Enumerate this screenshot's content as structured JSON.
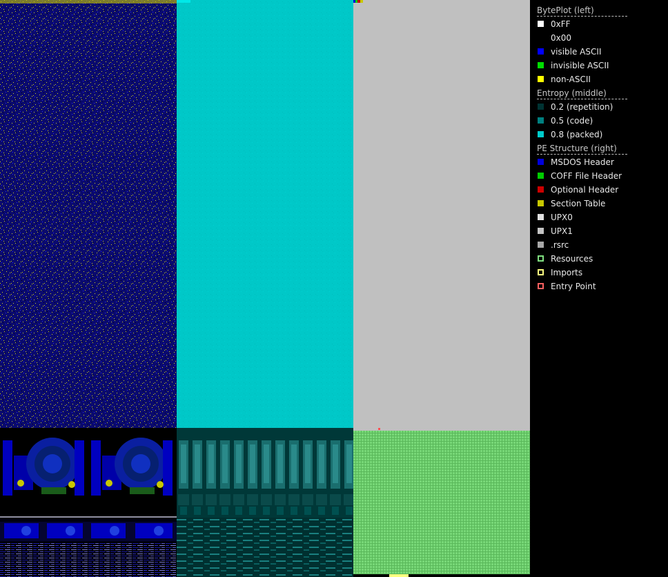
{
  "legend": {
    "groups": [
      {
        "title": "BytePlot (left)",
        "items": [
          {
            "label": "0xFF",
            "color": "#ffffff",
            "outline": ""
          },
          {
            "label": "0x00",
            "color": "#000000",
            "outline": ""
          },
          {
            "label": "visible ASCII",
            "color": "#0000ff",
            "outline": ""
          },
          {
            "label": "invisible ASCII",
            "color": "#00dd00",
            "outline": ""
          },
          {
            "label": "non-ASCII",
            "color": "#ffff00",
            "outline": ""
          }
        ]
      },
      {
        "title": "Entropy (middle)",
        "items": [
          {
            "label": "0.2 (repetition)",
            "color": "#003333",
            "outline": ""
          },
          {
            "label": "0.5 (code)",
            "color": "#008080",
            "outline": ""
          },
          {
            "label": "0.8 (packed)",
            "color": "#00cccc",
            "outline": ""
          }
        ]
      },
      {
        "title": "PE Structure (right)",
        "items": [
          {
            "label": "MSDOS Header",
            "color": "#0000dd",
            "outline": ""
          },
          {
            "label": "COFF File Header",
            "color": "#00cc00",
            "outline": ""
          },
          {
            "label": "Optional Header",
            "color": "#cc0000",
            "outline": ""
          },
          {
            "label": "Section Table",
            "color": "#c8c800",
            "outline": ""
          },
          {
            "label": "UPX0",
            "color": "#e0e0e0",
            "outline": ""
          },
          {
            "label": "UPX1",
            "color": "#c4c4c4",
            "outline": ""
          },
          {
            "label": ".rsrc",
            "color": "#a8a8a8",
            "outline": ""
          },
          {
            "label": "Resources",
            "color": "#000000",
            "outline": "#80e080"
          },
          {
            "label": "Imports",
            "color": "#000000",
            "outline": "#ffff80"
          },
          {
            "label": "Entry Point",
            "color": "#000000",
            "outline": "#ff6060"
          }
        ]
      }
    ]
  }
}
